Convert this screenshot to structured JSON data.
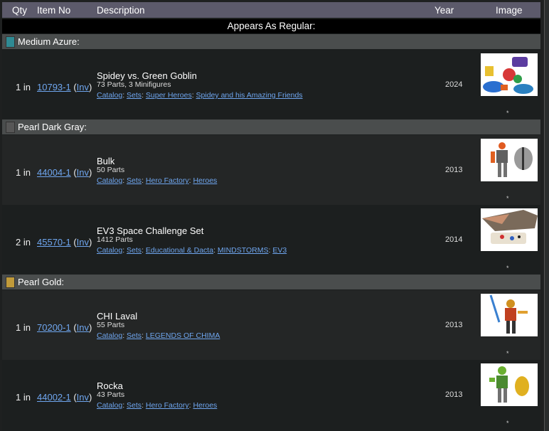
{
  "header": {
    "qty": "Qty",
    "item_no": "Item No",
    "description": "Description",
    "year": "Year",
    "image": "Image"
  },
  "appears_label": "Appears As Regular:",
  "groups": [
    {
      "color_name": "Medium Azure:",
      "swatch": "#2f8a93",
      "items": [
        {
          "qty": "1 in",
          "item_no": "10793-1",
          "inv": "Inv",
          "name": "Spidey vs. Green Goblin",
          "parts": "73 Parts, 3 Minifigures",
          "catalog": [
            "Catalog",
            "Sets",
            "Super Heroes",
            "Spidey and his Amazing Friends"
          ],
          "year": "2024",
          "image_dot": "*"
        }
      ]
    },
    {
      "color_name": "Pearl Dark Gray:",
      "swatch": "#575757",
      "items": [
        {
          "qty": "1 in",
          "item_no": "44004-1",
          "inv": "Inv",
          "name": "Bulk",
          "parts": "50 Parts",
          "catalog": [
            "Catalog",
            "Sets",
            "Hero Factory",
            "Heroes"
          ],
          "year": "2013",
          "image_dot": "*"
        },
        {
          "qty": "2 in",
          "item_no": "45570-1",
          "inv": "Inv",
          "name": "EV3 Space Challenge Set",
          "parts": "1412 Parts",
          "catalog": [
            "Catalog",
            "Sets",
            "Educational & Dacta",
            "MINDSTORMS",
            "EV3"
          ],
          "year": "2014",
          "image_dot": "*"
        }
      ]
    },
    {
      "color_name": "Pearl Gold:",
      "swatch": "#c09a3a",
      "items": [
        {
          "qty": "1 in",
          "item_no": "70200-1",
          "inv": "Inv",
          "name": "CHI Laval",
          "parts": "55 Parts",
          "catalog": [
            "Catalog",
            "Sets",
            "LEGENDS OF CHIMA"
          ],
          "year": "2013",
          "image_dot": "*"
        },
        {
          "qty": "1 in",
          "item_no": "44002-1",
          "inv": "Inv",
          "name": "Rocka",
          "parts": "43 Parts",
          "catalog": [
            "Catalog",
            "Sets",
            "Hero Factory",
            "Heroes"
          ],
          "year": "2013",
          "image_dot": "*"
        }
      ]
    }
  ],
  "colors": {
    "header_bg": "#5c5a6b",
    "link": "#6fa6ef",
    "group_bg": "#4a4d4d"
  }
}
